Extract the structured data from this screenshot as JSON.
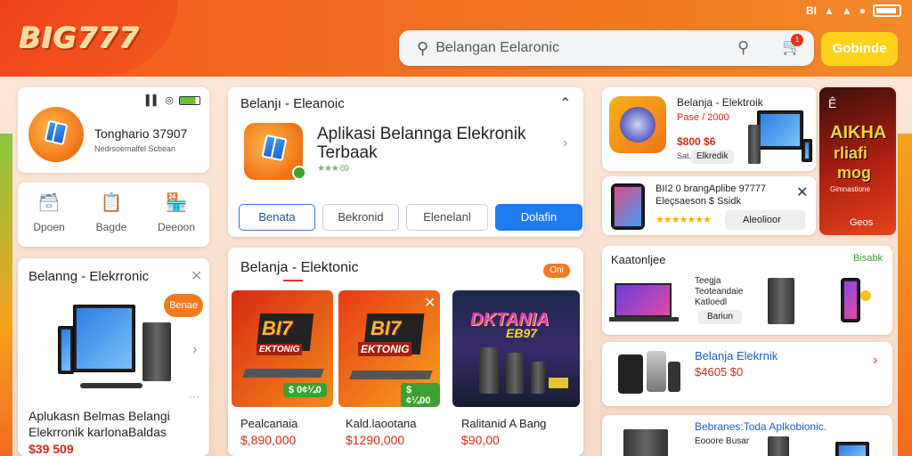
{
  "header": {
    "logo": "BIG777",
    "status": {
      "carrier": "BI",
      "signal": "▐",
      "wifi": "◔"
    },
    "search_placeholder": "Belangan Eelaronic",
    "cart_count": "1",
    "go_button": "Gobinde"
  },
  "profile_card": {
    "title": "Tonghario 37907",
    "subtitle": "Nedrsoemalfel Scbean"
  },
  "left_nav": [
    {
      "label": "Dpoen",
      "icon": "folder-icon"
    },
    {
      "label": "Bagde",
      "icon": "clipboard-icon"
    },
    {
      "label": "Deeoon",
      "icon": "store-icon"
    }
  ],
  "left_product": {
    "header": "Belanng - Elekrronic",
    "badge": "Benae",
    "title": "Aplukasn Belmas Belangi Elekrronik karlonaBaldas",
    "price": "$39 509",
    "more": "···"
  },
  "app_card": {
    "header": "Belanjı - Eleanoic",
    "title": "Aplikasi Belannga Elekronik Terbaak",
    "rating": "★★★ 69",
    "tabs": [
      "Benata",
      "Bekronid",
      "Elenelanl",
      "Dolafin"
    ]
  },
  "main_section": {
    "title": "Belanja - Elektonic",
    "badge": "Oni",
    "products": [
      {
        "name": "Pealcanaia",
        "price": "$,890,000",
        "tag": "$ 0¢¼0",
        "banner": "BI7",
        "banner_sub": "EKTONIG"
      },
      {
        "name": "Kald.laootana",
        "price": "$1290,000",
        "tag": "$¢¼00",
        "banner": "BI7",
        "banner_sub": "EKTONIG"
      },
      {
        "name": "Ralitanid A Bang",
        "price": "$90,00",
        "banner": "DKTANIA",
        "banner_sub": "EB97"
      }
    ]
  },
  "right_top_card": {
    "title": "Belanja - Elektroik",
    "line2": "Pase / 2000",
    "price": "$800 $6",
    "line4": "Sat. 1",
    "chip": "Elkredik"
  },
  "right_banner": {
    "top": "Ê",
    "big1": "AIKHA",
    "big2": "rliafi",
    "big3": "mog",
    "small": "Gimnastione",
    "bottom": "Geos"
  },
  "right_mid_card": {
    "title": "BII2 0 brangAplibe 97777",
    "subtitle": "Eleçsaeson $ Ssidk",
    "stars": "★★★★★★★",
    "chip": "Aleolioor"
  },
  "right_list1": {
    "title": "Kaatonljee",
    "link": "Bisabk",
    "lines": [
      "Teegja",
      "Teoteandaie",
      "Katloedl"
    ],
    "chip": "Bariun"
  },
  "right_list2": {
    "title": "Belanja Elekrnik",
    "price": "$4605 $0"
  },
  "right_list3": {
    "title": "Bebranes:Toda Aplkobionic.",
    "sub": "Eooore Busar"
  },
  "colors": {
    "brand_orange": "#f26a21",
    "accent_yellow": "#ffd21c",
    "primary_blue": "#1e7cf0",
    "price_red": "#d82a14"
  }
}
